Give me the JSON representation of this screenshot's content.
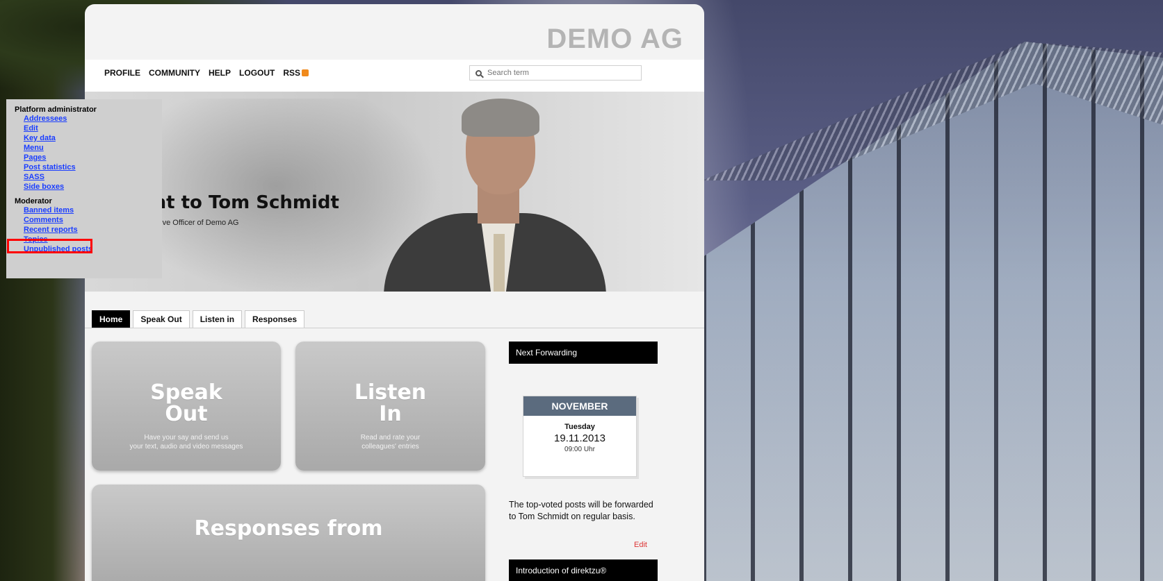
{
  "brand": "DEMO AG",
  "nav": {
    "items": [
      "PROFILE",
      "COMMUNITY",
      "HELP",
      "LOGOUT",
      "RSS"
    ]
  },
  "search": {
    "placeholder": "Search term"
  },
  "hero": {
    "title": "ght to Tom Schmidt",
    "subtitle": "utive Officer of Demo AG"
  },
  "tabs": [
    "Home",
    "Speak Out",
    "Listen in",
    "Responses"
  ],
  "tiles": {
    "speak": {
      "title_line1": "Speak",
      "title_line2": "Out",
      "desc_line1": "Have your say and send us",
      "desc_line2": "your text, audio and video messages"
    },
    "listen": {
      "title_line1": "Listen",
      "title_line2": "In",
      "desc_line1": "Read and rate your",
      "desc_line2": "colleagues' entries"
    },
    "responses": {
      "title_line1": "Responses from"
    }
  },
  "sidebar": {
    "next_forwarding": "Next Forwarding",
    "calendar": {
      "month": "NOVEMBER",
      "weekday": "Tuesday",
      "date": "19.11.2013",
      "time": "09:00 Uhr"
    },
    "text": "The top-voted posts will be forwarded to Tom Schmidt on regular basis.",
    "edit": "Edit",
    "introduction": "Introduction of direktzu®"
  },
  "admin": {
    "platform_admin": {
      "heading": "Platform administrator",
      "links": [
        "Addressees",
        "Edit",
        "Key data",
        "Menu",
        "Pages",
        "Post statistics",
        "SASS",
        "Side boxes"
      ]
    },
    "moderator": {
      "heading": "Moderator",
      "links": [
        "Banned items",
        "Comments",
        "Recent reports",
        "Topics",
        "Unpublished posts"
      ]
    },
    "highlighted_link": "Topics"
  },
  "colors": {
    "tab_active": "#000000",
    "admin_link": "#1a3dff",
    "highlight": "#ff0000",
    "calendar_month": "#5b6b7e",
    "edit_link": "#dd3333"
  }
}
